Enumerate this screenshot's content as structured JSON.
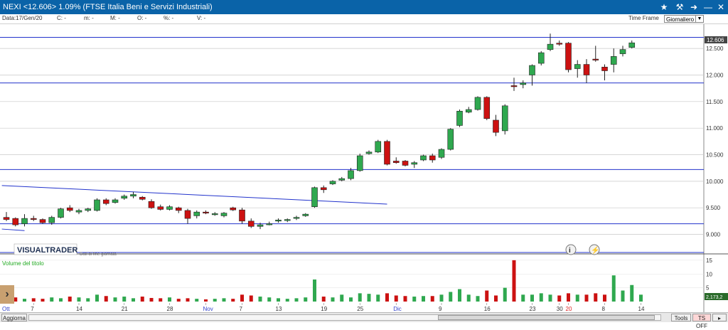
{
  "window": {
    "title": "NEXI <12.606> 1.09%  (FTSE Italia Beni e Servizi Industriali)",
    "icons": [
      "star-icon",
      "hammer-icon",
      "pin-icon",
      "minimize-icon",
      "close-icon"
    ]
  },
  "infobar": {
    "date": "Data:17/Gen/20",
    "c": "C: -",
    "m": "m: -",
    "M": "M: -",
    "O": "O: -",
    "pct": "%: -",
    "V": "V: -",
    "timeframe_label": "Time Frame",
    "timeframe_value": "Giornaliero"
  },
  "chart": {
    "price_label": "12.606",
    "watermark": "VISUALTRADER",
    "watermark_sub": "Dati di fine giornata",
    "volume_title": "Volume del titolo",
    "volume_label": "2,173,2",
    "colors": {
      "up": "#2fa84f",
      "down": "#cc1111",
      "line": "#2233cc",
      "volume_title": "#22aa22"
    }
  },
  "chart_data": {
    "type": "candlestick",
    "price_axis": {
      "ylim": [
        8.9,
        12.85
      ],
      "ticks": [
        "12.500",
        "12.000",
        "11.500",
        "11.000",
        "10.500",
        "10.000",
        "9.500",
        "9.000"
      ]
    },
    "volume_axis": {
      "ylim": [
        0,
        16
      ],
      "ticks": [
        "15",
        "10",
        "5"
      ]
    },
    "x_labels": [
      {
        "text": "Ott",
        "i": -1
      },
      {
        "text": "7",
        "i": 3
      },
      {
        "text": "14",
        "i": 8
      },
      {
        "text": "21",
        "i": 13
      },
      {
        "text": "28",
        "i": 18
      },
      {
        "text": "Nov",
        "i": 22
      },
      {
        "text": "7",
        "i": 26
      },
      {
        "text": "13",
        "i": 30
      },
      {
        "text": "19",
        "i": 35
      },
      {
        "text": "25",
        "i": 39
      },
      {
        "text": "Dic",
        "i": 43
      },
      {
        "text": "9",
        "i": 48
      },
      {
        "text": "16",
        "i": 53
      },
      {
        "text": "23",
        "i": 58
      },
      {
        "text": "30",
        "i": 61
      },
      {
        "text": "20",
        "i": 62
      },
      {
        "text": "8",
        "i": 66
      },
      {
        "text": "14",
        "i": 70
      }
    ],
    "candles": [
      [
        9.32,
        9.42,
        9.25,
        9.28
      ],
      [
        9.3,
        9.32,
        9.15,
        9.18
      ],
      [
        9.2,
        9.38,
        9.15,
        9.3
      ],
      [
        9.3,
        9.35,
        9.25,
        9.28
      ],
      [
        9.28,
        9.3,
        9.2,
        9.22
      ],
      [
        9.22,
        9.35,
        9.18,
        9.32
      ],
      [
        9.32,
        9.5,
        9.3,
        9.48
      ],
      [
        9.5,
        9.55,
        9.42,
        9.45
      ],
      [
        9.42,
        9.48,
        9.38,
        9.45
      ],
      [
        9.45,
        9.5,
        9.42,
        9.48
      ],
      [
        9.45,
        9.68,
        9.43,
        9.65
      ],
      [
        9.65,
        9.68,
        9.55,
        9.58
      ],
      [
        9.6,
        9.68,
        9.58,
        9.65
      ],
      [
        9.68,
        9.75,
        9.65,
        9.72
      ],
      [
        9.72,
        9.8,
        9.68,
        9.75
      ],
      [
        9.7,
        9.72,
        9.64,
        9.66
      ],
      [
        9.62,
        9.66,
        9.48,
        9.5
      ],
      [
        9.52,
        9.56,
        9.45,
        9.47
      ],
      [
        9.47,
        9.55,
        9.45,
        9.52
      ],
      [
        9.5,
        9.52,
        9.4,
        9.45
      ],
      [
        9.45,
        9.48,
        9.2,
        9.3
      ],
      [
        9.35,
        9.45,
        9.3,
        9.42
      ],
      [
        9.42,
        9.45,
        9.38,
        9.4
      ],
      [
        9.38,
        9.42,
        9.35,
        9.39
      ],
      [
        9.35,
        9.42,
        9.32,
        9.4
      ],
      [
        9.5,
        9.52,
        9.44,
        9.46
      ],
      [
        9.46,
        9.5,
        9.2,
        9.25
      ],
      [
        9.25,
        9.3,
        9.12,
        9.15
      ],
      [
        9.15,
        9.22,
        9.1,
        9.18
      ],
      [
        9.2,
        9.24,
        9.17,
        9.2
      ],
      [
        9.25,
        9.3,
        9.22,
        9.27
      ],
      [
        9.27,
        9.3,
        9.23,
        9.28
      ],
      [
        9.3,
        9.35,
        9.27,
        9.32
      ],
      [
        9.35,
        9.4,
        9.33,
        9.38
      ],
      [
        9.52,
        9.9,
        9.5,
        9.88
      ],
      [
        9.88,
        9.92,
        9.78,
        9.84
      ],
      [
        9.95,
        10.02,
        9.93,
        10.0
      ],
      [
        10.02,
        10.08,
        10.0,
        10.05
      ],
      [
        10.05,
        10.25,
        10.02,
        10.2
      ],
      [
        10.2,
        10.52,
        10.18,
        10.48
      ],
      [
        10.52,
        10.58,
        10.5,
        10.55
      ],
      [
        10.55,
        10.78,
        10.53,
        10.75
      ],
      [
        10.75,
        10.78,
        10.3,
        10.32
      ],
      [
        10.38,
        10.45,
        10.33,
        10.35
      ],
      [
        10.38,
        10.4,
        10.28,
        10.3
      ],
      [
        10.32,
        10.38,
        10.25,
        10.35
      ],
      [
        10.4,
        10.5,
        10.38,
        10.48
      ],
      [
        10.48,
        10.52,
        10.35,
        10.4
      ],
      [
        10.45,
        10.62,
        10.42,
        10.6
      ],
      [
        10.6,
        11.0,
        10.58,
        10.98
      ],
      [
        11.05,
        11.35,
        11.02,
        11.32
      ],
      [
        11.3,
        11.4,
        11.28,
        11.35
      ],
      [
        11.35,
        11.6,
        11.33,
        11.58
      ],
      [
        11.58,
        11.6,
        11.15,
        11.18
      ],
      [
        11.15,
        11.25,
        10.85,
        10.92
      ],
      [
        10.95,
        11.45,
        10.88,
        11.42
      ],
      [
        11.8,
        11.95,
        11.7,
        11.78
      ],
      [
        11.82,
        11.9,
        11.75,
        11.85
      ],
      [
        12.0,
        12.2,
        11.8,
        12.18
      ],
      [
        12.22,
        12.45,
        12.18,
        12.42
      ],
      [
        12.48,
        12.78,
        12.45,
        12.58
      ],
      [
        12.6,
        12.65,
        12.55,
        12.58
      ],
      [
        12.6,
        12.62,
        12.05,
        12.1
      ],
      [
        12.12,
        12.28,
        11.95,
        12.2
      ],
      [
        12.2,
        12.3,
        11.85,
        12.0
      ],
      [
        12.3,
        12.55,
        12.25,
        12.28
      ],
      [
        12.15,
        12.2,
        11.9,
        12.08
      ],
      [
        12.2,
        12.5,
        12.05,
        12.35
      ],
      [
        12.4,
        12.55,
        12.35,
        12.48
      ],
      [
        12.52,
        12.65,
        12.5,
        12.606
      ]
    ],
    "volumes": [
      2,
      1.5,
      1,
      1.2,
      1,
      1.5,
      1.2,
      1.8,
      1.5,
      1.2,
      2.5,
      2,
      1.5,
      1.8,
      1.2,
      1.8,
      1.3,
      1.2,
      1.5,
      1,
      1.2,
      1,
      0.8,
      1,
      1.2,
      1,
      2.5,
      2.2,
      1.8,
      1.5,
      1.2,
      1,
      1.2,
      1.5,
      8,
      1.8,
      1.5,
      2.5,
      1.5,
      3,
      2.8,
      2.5,
      3,
      2.2,
      2,
      1.8,
      2,
      2,
      2.5,
      3.5,
      4.5,
      2.5,
      2,
      4,
      2.2,
      5,
      15,
      2.5,
      2.5,
      3,
      2.5,
      2.2,
      3,
      2.5,
      2.5,
      3,
      2.5,
      9.5,
      4,
      6,
      2.5
    ],
    "horizontal_lines": [
      12.71,
      11.85,
      10.22,
      9.2
    ],
    "trendlines": [
      [
        -0.5,
        9.92,
        42,
        9.57
      ],
      [
        -0.5,
        9.1,
        2,
        9.07
      ]
    ]
  },
  "bottombar": {
    "aggiorna": "Aggiorna",
    "tools": "Tools",
    "tsoff": "TS OFF"
  }
}
